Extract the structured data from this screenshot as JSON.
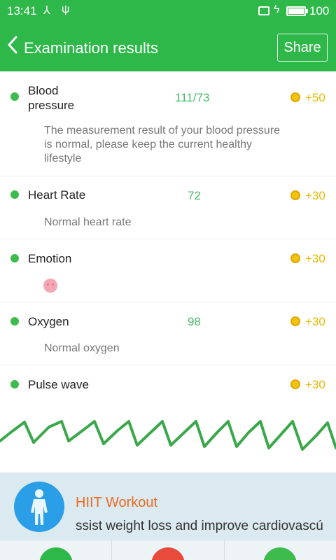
{
  "status_bar": {
    "time": "13:41",
    "battery_percent": "100",
    "battery_level": 1.0,
    "icons": [
      "usb-share-icon",
      "usb-icon",
      "notification-icon",
      "charging-icon",
      "battery-icon"
    ]
  },
  "header": {
    "title": "Examination results",
    "share_label": "Share",
    "back_icon": "chevron-left-icon"
  },
  "results": [
    {
      "label_line1": "Blood",
      "label_line2": "pressure",
      "value": "111/73",
      "reward": "+50",
      "desc": "The measurement result of your blood pressure is normal, please keep the current healthy lifestyle"
    },
    {
      "label": "Heart Rate",
      "value": "72",
      "reward": "+30",
      "desc": "Normal heart rate"
    },
    {
      "label": "Emotion",
      "value": "",
      "reward": "+30",
      "emoji_icon": "smiley-face-icon"
    },
    {
      "label": "Oxygen",
      "value": "98",
      "reward": "+30",
      "desc": "Normal oxygen"
    },
    {
      "label": "Pulse wave",
      "value": "",
      "reward": "+30"
    }
  ],
  "banner": {
    "title": "HIIT Workout",
    "subtitle": "ssist weight loss and improve cardiovascú",
    "icon": "human-body-icon"
  },
  "colors": {
    "primary_green": "#2fb84a",
    "value_green": "#4ab96a",
    "reward_gold": "#e6b800",
    "banner_orange": "#ee6a1f",
    "wave_green": "#3aa84a"
  },
  "bottom_nav": [
    {
      "icon": "grid-icon",
      "color": "#2fb84a"
    },
    {
      "icon": "gauge-icon",
      "color": "#e84b3c"
    },
    {
      "icon": "running-icon",
      "color": "#3dbb4d"
    }
  ]
}
